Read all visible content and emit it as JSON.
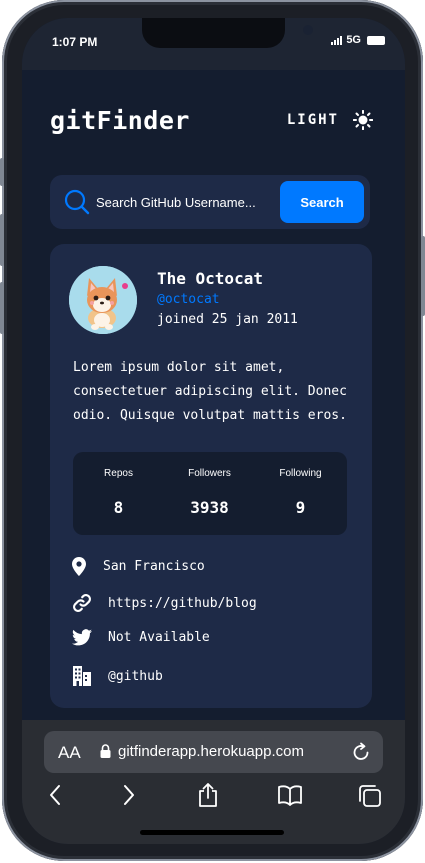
{
  "status_bar": {
    "time": "1:07 PM",
    "network": "5G"
  },
  "app": {
    "logo": "gitFinder",
    "theme_toggle_label": "LIGHT",
    "search": {
      "placeholder": "Search GitHub Username...",
      "button_label": "Search"
    },
    "profile": {
      "name": "The Octocat",
      "handle": "@octocat",
      "joined": "joined 25 jan 2011",
      "bio": "Lorem ipsum dolor sit amet, consectetuer adipiscing elit. Donec odio. Quisque volutpat mattis eros.",
      "stats": [
        {
          "label": "Repos",
          "value": "8"
        },
        {
          "label": "Followers",
          "value": "3938"
        },
        {
          "label": "Following",
          "value": "9"
        }
      ],
      "location": "San Francisco",
      "blog": "https://github/blog",
      "twitter": "Not Available",
      "company": "@github"
    }
  },
  "browser": {
    "text_size_label": "AA",
    "url": "gitfinderapp.herokuapp.com"
  },
  "colors": {
    "background": "#141d2f",
    "card": "#1e2a47",
    "accent": "#0079ff",
    "text": "#ffffff"
  }
}
